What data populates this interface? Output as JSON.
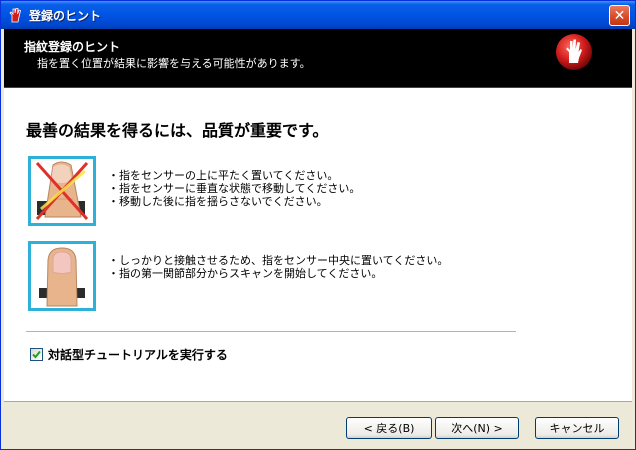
{
  "window": {
    "title": "登録のヒント",
    "close_label": "✕"
  },
  "header": {
    "title": "指紋登録のヒント",
    "subtitle": "指を置く位置が結果に影響を与える可能性があります。",
    "icon": "red-hand-fingerprint-icon"
  },
  "main": {
    "heading": "最善の結果を得るには、品質が重要です。",
    "bad_tips": [
      "・指をセンサーの上に平たく置いてください。",
      "・指をセンサーに垂直な状態で移動してください。",
      "・移動した後に指を揺らさないでください。"
    ],
    "good_tips": [
      "・しっかりと接触させるため、指をセンサー中央に置いてください。",
      "・指の第一関節部分からスキャンを開始してください。"
    ],
    "tutorial_checkbox": {
      "label": "対話型チュートリアルを実行する",
      "checked": true
    }
  },
  "footer": {
    "back_label": "< 戻る(B)",
    "next_label": "次へ(N) >",
    "cancel_label": "キャンセル"
  },
  "colors": {
    "title_bar": "#0054e3",
    "header_bg": "#000000",
    "thumb_border": "#2fb0d9",
    "cross": "#e0302a",
    "hand_icon": "#d11c1c"
  }
}
